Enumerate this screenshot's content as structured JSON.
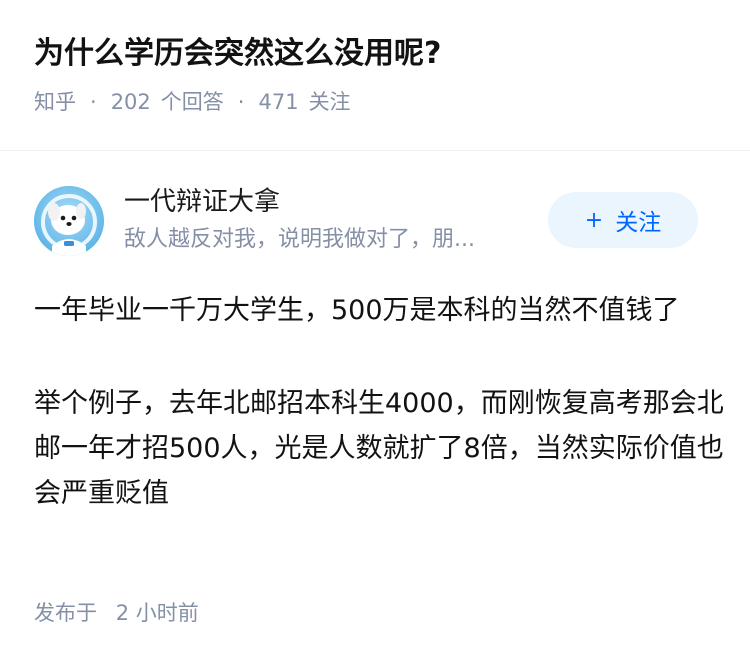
{
  "question": {
    "title": "为什么学历会突然这么没用呢?",
    "source": "知乎",
    "separator": "·",
    "answer_count": "202",
    "answer_label": "个回答",
    "follow_count": "471",
    "follow_label": "关注"
  },
  "author": {
    "name": "一代辩证大拿",
    "bio": "敌人越反对我，说明我做对了，朋...",
    "follow_button_plus": "+",
    "follow_button_label": "关注",
    "avatar_icon": "cartoon-dog-astronaut"
  },
  "answer": {
    "paragraphs": [
      "一年毕业一千万大学生，500万是本科的当然不值钱了",
      "举个例子，去年北邮招本科生4000，而刚恢复高考那会北邮一年才招500人，光是人数就扩了8倍，当然实际价值也会严重贬值"
    ]
  },
  "footer": {
    "published_label": "发布于",
    "published_time": "2 小时前"
  },
  "colors": {
    "title": "#121212",
    "meta": "#8590a6",
    "accent": "#0066ff",
    "follow_bg": "#ebf5fd"
  }
}
